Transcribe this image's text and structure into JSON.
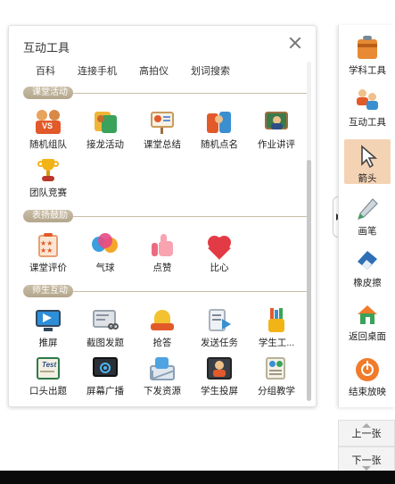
{
  "panel": {
    "title": "互动工具",
    "top_links": [
      "百科",
      "连接手机",
      "高拍仪",
      "划词搜索"
    ],
    "sections": [
      {
        "name": "课堂活动",
        "items": [
          "随机组队",
          "接龙活动",
          "课堂总结",
          "随机点名",
          "作业讲评",
          "团队竞赛"
        ]
      },
      {
        "name": "表扬鼓励",
        "items": [
          "课堂评价",
          "气球",
          "点赞",
          "比心"
        ]
      },
      {
        "name": "师生互动",
        "items": [
          "推屏",
          "截图发题",
          "抢答",
          "发送任务",
          "学生工...",
          "口头出题",
          "屏幕广播",
          "下发资源",
          "学生投屏",
          "分组教学"
        ]
      }
    ]
  },
  "sidebar": {
    "items": [
      "学科工具",
      "互动工具",
      "箭头",
      "画笔",
      "橡皮擦",
      "返回桌面",
      "结束放映"
    ],
    "active": "箭头"
  },
  "pager": {
    "prev": "上一张",
    "next": "下一张"
  },
  "colors": {
    "section_pill": "#b8aa90",
    "active_bg": "#f4d3b4"
  }
}
